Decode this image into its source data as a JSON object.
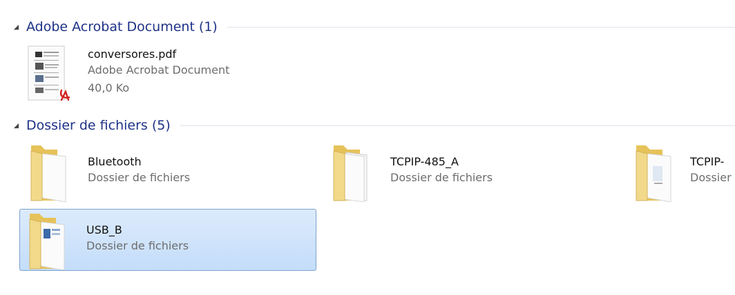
{
  "groups": [
    {
      "title": "Adobe Acrobat Document (1)",
      "items": [
        {
          "name": "conversores.pdf",
          "type": "Adobe Acrobat Document",
          "size": "40,0 Ko",
          "icon": "pdf-file-icon"
        }
      ]
    },
    {
      "title": "Dossier de fichiers (5)",
      "items": [
        {
          "name": "Bluetooth",
          "type": "Dossier de fichiers",
          "icon": "folder-icon"
        },
        {
          "name": "TCPIP-485_A",
          "type": "Dossier de fichiers",
          "icon": "folder-icon"
        },
        {
          "name": "TCPIP-",
          "type": "Dossier",
          "icon": "folder-icon"
        },
        {
          "name": "USB_B",
          "type": "Dossier de fichiers",
          "icon": "folder-icon",
          "selected": true
        }
      ]
    }
  ],
  "colors": {
    "group_title": "#1e3287",
    "selection_fill": "#cfe3fb",
    "selection_border": "#7da2ce",
    "secondary_text": "#6d6d6d"
  }
}
